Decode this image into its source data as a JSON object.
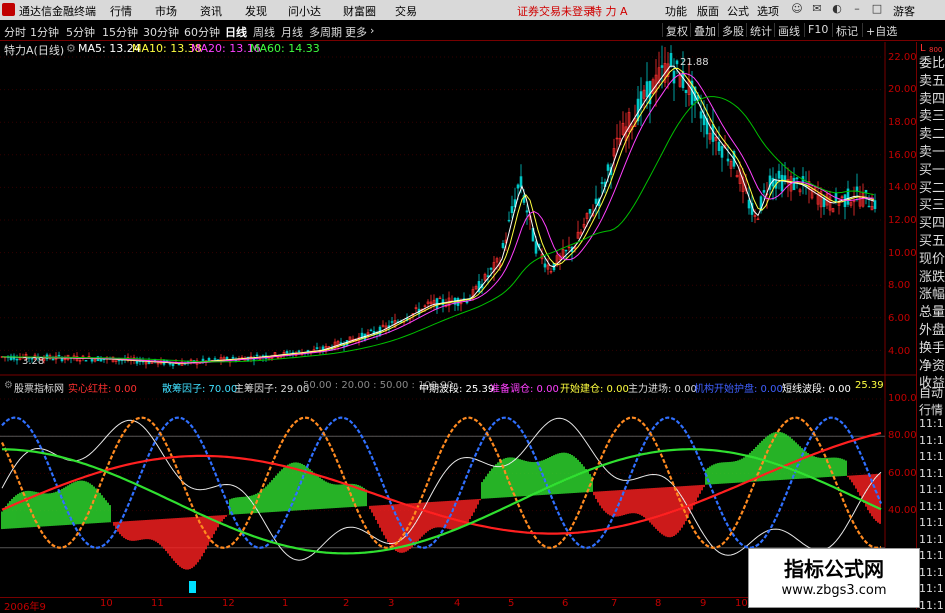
{
  "titlebar": {
    "app_title": "通达信金融终端",
    "menus": [
      "行情",
      "市场",
      "资讯",
      "发现",
      "问小达",
      "财富圈",
      "交易"
    ],
    "login_notice": "证券交易未登录",
    "stock_title": "特 力 A",
    "right_menus": [
      "功能",
      "版面",
      "公式",
      "选项"
    ],
    "guest": "游客"
  },
  "toolbar": {
    "periods": [
      "分时",
      "1分钟",
      "5分钟",
      "15分钟",
      "30分钟",
      "60分钟",
      "日线",
      "周线",
      "月线",
      "多周期",
      "更多"
    ],
    "active_period": "日线",
    "right_buttons": [
      "复权",
      "叠加",
      "多股",
      "统计",
      "画线",
      "F10",
      "标记",
      "+自选"
    ]
  },
  "info": {
    "name": "特力A(日线)",
    "ma5": "MA5: 13.24",
    "ma10": "MA10: 13.38",
    "ma20": "MA20: 13.16",
    "ma60": "MA60: 14.33"
  },
  "price_axis": [
    "22.00",
    "20.00",
    "18.00",
    "16.00",
    "14.00",
    "12.00",
    "10.00",
    "8.00",
    "6.00",
    "4.00"
  ],
  "price_annotations": {
    "high": "21.88",
    "low": "3.28"
  },
  "right_panel": {
    "top_labels": [
      "L",
      "800"
    ],
    "items": [
      "委比",
      "卖五",
      "卖四",
      "卖三",
      "卖二",
      "卖一",
      "买一",
      "买二",
      "买三",
      "买四",
      "买五",
      "现价",
      "涨跌",
      "涨幅",
      "总量",
      "外盘",
      "换手",
      "净资",
      "收益"
    ],
    "lower_items": [
      "自动",
      "行情",
      "11:1",
      "11:1",
      "11:1",
      "11:1",
      "11:1",
      "11:1",
      "11:1",
      "11:1",
      "11:1",
      "11:1",
      "11:1",
      "11:1"
    ]
  },
  "indicator": {
    "name": "股票指标网",
    "fields": [
      {
        "label": "实心红柱: 0.00",
        "color": "#ff3030"
      },
      {
        "label": "散筹因子: 70.00",
        "color": "#40e0ff"
      },
      {
        "label": "主筹因子: 29.00",
        "color": "#dddddd"
      },
      {
        "label": "50.00 : 20.00 : 50.00 : 100.00",
        "color": "#888888"
      },
      {
        "label": "中期波段: 25.39",
        "color": "#ffffff"
      },
      {
        "label": "准备调仓: 0.00",
        "color": "#ff40ff"
      },
      {
        "label": "开始建仓: 0.00",
        "color": "#ffff40"
      },
      {
        "label": "主力进场: 0.00",
        "color": "#dddddd"
      },
      {
        "label": "机构开始护盘: 0.00",
        "color": "#4060ff"
      },
      {
        "label": "短线波段: 0.00",
        "color": "#ffffff"
      },
      {
        "label": "25.39",
        "color": "#ffff40"
      }
    ],
    "axis": [
      "100.00",
      "80.00",
      "60.00",
      "40.00"
    ]
  },
  "dates": [
    "2006年9",
    "10",
    "11",
    "12",
    "1",
    "2",
    "3",
    "4",
    "5",
    "6",
    "7",
    "8",
    "9",
    "10"
  ],
  "watermark": {
    "title": "指标公式网",
    "url": "www.zbgs3.com"
  },
  "colors": {
    "up": "#ff3030",
    "down": "#00c8c8",
    "ma5": "#ffffff",
    "ma10": "#ffff40",
    "ma20": "#ff40ff",
    "ma60": "#00c000",
    "axis": "#c00000"
  }
}
